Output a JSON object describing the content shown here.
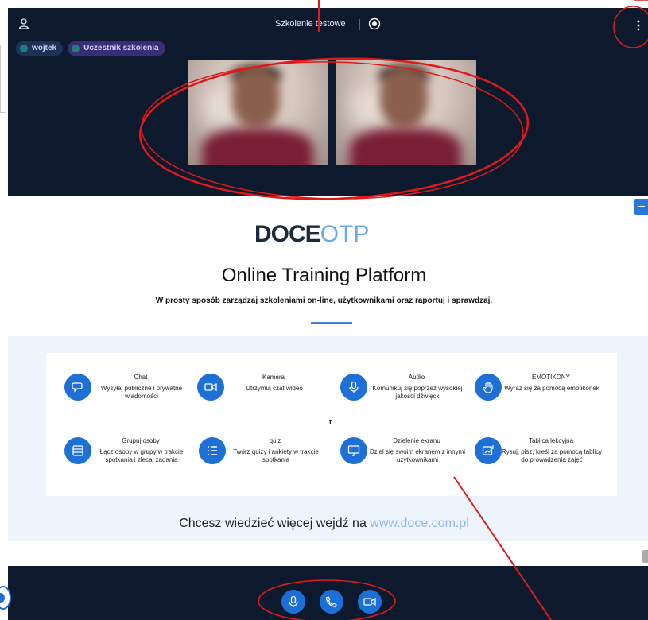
{
  "header": {
    "title": "Szkolenie testowe"
  },
  "participants": [
    {
      "name": "wojtek"
    },
    {
      "name": "Uczestnik szkolenia"
    }
  ],
  "page": {
    "logo_bold": "DOCE",
    "logo_light": "OTP",
    "headline": "Online Training Platform",
    "subline": "W prosty sposób zarządzaj szkoleniami on-line, użytkownikami oraz raportuj i sprawdzaj.",
    "stray_char": "t",
    "cta_text": "Chcesz wiedzieć więcej wejdź na ",
    "cta_link": "www.doce.com.pl"
  },
  "features": [
    {
      "title": "Chat",
      "desc": "Wysyłaj publiczne i prywatne wiadomości",
      "icon": "chat-icon"
    },
    {
      "title": "Kamera",
      "desc": "Utrzymuj czat wideo",
      "icon": "camera-icon"
    },
    {
      "title": "Audio",
      "desc": "Komunikuj się poprzez wysokiej jakości dźwięck",
      "icon": "microphone-icon"
    },
    {
      "title": "EMOTIKONY",
      "desc": "Wyraź się za pomocą emotikonek",
      "icon": "hand-icon"
    },
    {
      "title": "Grupuj osoby",
      "desc": "Łącz osoby w grupy w trakcie spotkania i zlecaj zadania",
      "icon": "group-icon"
    },
    {
      "title": "quiz",
      "desc": "Twórz quizy i ankiety w trakcie spotkania",
      "icon": "list-icon"
    },
    {
      "title": "Dzielenie ekranu",
      "desc": "Dziel się swoim ekranem z innymi użytkownikami",
      "icon": "monitor-icon"
    },
    {
      "title": "Tablica lekcyjna",
      "desc": "Rysuj, pisz, kreśl za pomocą tablicy do prowadzenia zajęć",
      "icon": "whiteboard-icon"
    }
  ],
  "colors": {
    "dark_bg": "#0d1a2e",
    "accent": "#1d6fd8",
    "annotation": "#e0191b",
    "link": "#8eb8ee"
  }
}
